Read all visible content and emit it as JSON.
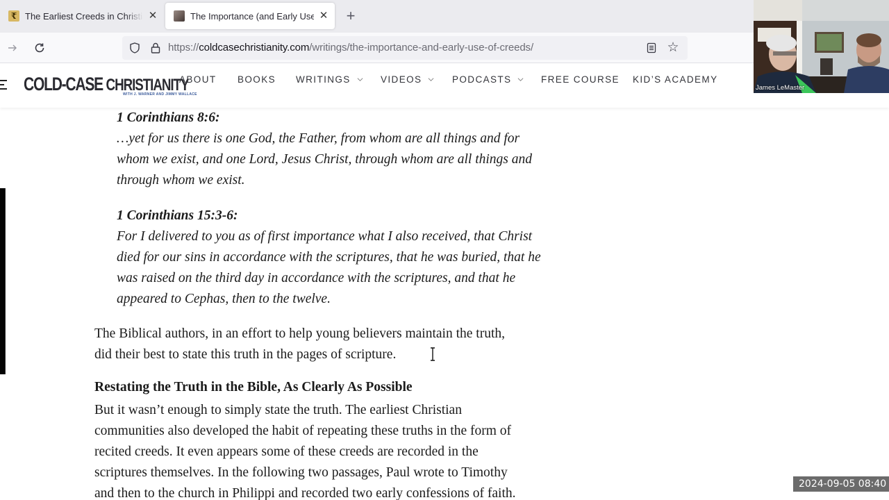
{
  "browser": {
    "tabs": [
      {
        "title": "The Earliest Creeds in Christianity",
        "favicon": "r-logo-icon",
        "active": false
      },
      {
        "title": "The Importance (and Early Use)",
        "favicon": "author-photo-icon",
        "active": true
      }
    ],
    "new_tab_label": "+",
    "close_glyph": "✕",
    "url": {
      "scheme": "https://",
      "domain": "coldcasechristianity.com",
      "path": "/writings/the-importance-and-early-use-of-creeds/"
    }
  },
  "site": {
    "logo": {
      "main_bold": "COLD-CASE ",
      "main_light": "CHRISTIANITY",
      "tagline": "WITH J. WARNER AND JIMMY WALLACE"
    },
    "menu": [
      {
        "label": "ABOUT",
        "has_dropdown": false
      },
      {
        "label": "BOOKS",
        "has_dropdown": false
      },
      {
        "label": "WRITINGS",
        "has_dropdown": true
      },
      {
        "label": "VIDEOS",
        "has_dropdown": true
      },
      {
        "label": "PODCASTS",
        "has_dropdown": true
      },
      {
        "label": "FREE COURSE",
        "has_dropdown": false
      },
      {
        "label": "KID’S ACADEMY",
        "has_dropdown": false
      }
    ]
  },
  "article": {
    "quotes": [
      {
        "reference": "1 Corinthians 8:6:",
        "lines": [
          "…yet for us there is one God, the Father, from whom are all things and for",
          "whom we exist, and one Lord, Jesus Christ, through whom are all things and",
          "through whom we exist."
        ]
      },
      {
        "reference": "1 Corinthians 15:3-6:",
        "lines": [
          "For I delivered to you as of first importance what I also received, that Christ",
          "died for our sins in accordance with the scriptures, that he was buried, that he",
          "was raised on the third day in accordance with the scriptures, and that he",
          "appeared to Cephas, then to the twelve."
        ]
      }
    ],
    "paragraph1": [
      "The Biblical authors, in an effort to help young believers maintain the truth,",
      "did their best to state this truth in the pages of scripture."
    ],
    "heading": "Restating the Truth in the Bible, As Clearly As Possible",
    "paragraph2": [
      "But it wasn’t enough to simply state the truth. The earliest Christian",
      "communities also developed the habit of repeating these truths in the form of",
      "recited creeds. It even appears some of these creeds are recorded in the",
      "scriptures themselves. In the following two passages, Paul wrote to Timothy",
      "and then to the church in Philippi and recorded two early confessions of faith."
    ]
  },
  "video_call": {
    "participant_name": "James LeMaster"
  },
  "timestamp": "2024-09-05  08:40"
}
